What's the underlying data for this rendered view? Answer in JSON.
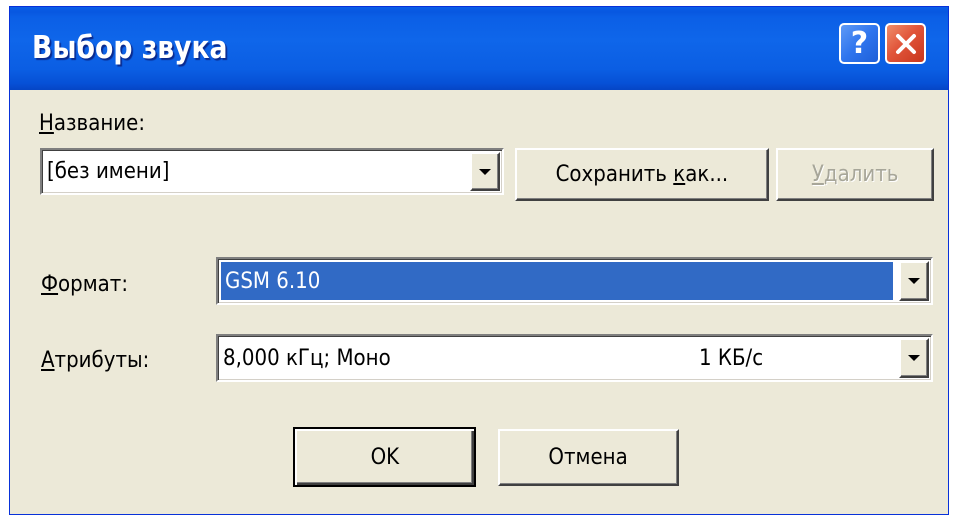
{
  "window": {
    "title": "Выбор звука",
    "help_glyph": "?",
    "close_icon": "close-x-icon"
  },
  "name_section": {
    "label_mnemonic": "Н",
    "label_rest": "азвание:",
    "value": "[без имени]",
    "save_as_prefix": "Сохранить ",
    "save_as_mnemonic": "к",
    "save_as_rest": "ак...",
    "delete_mnemonic": "У",
    "delete_rest": "далить"
  },
  "format_section": {
    "label_mnemonic": "Ф",
    "label_rest": "ормат:",
    "value": "GSM 6.10"
  },
  "attributes_section": {
    "label_mnemonic": "А",
    "label_rest": "трибуты:",
    "value": "8,000 кГц; Моно",
    "rate": "1 КБ/с"
  },
  "buttons": {
    "ok": "OK",
    "cancel": "Отмена"
  },
  "colors": {
    "title_bar": "#0b5ee3",
    "dialog_bg": "#ece9d8",
    "selection": "#316ac5",
    "close_button": "#e1553a"
  }
}
